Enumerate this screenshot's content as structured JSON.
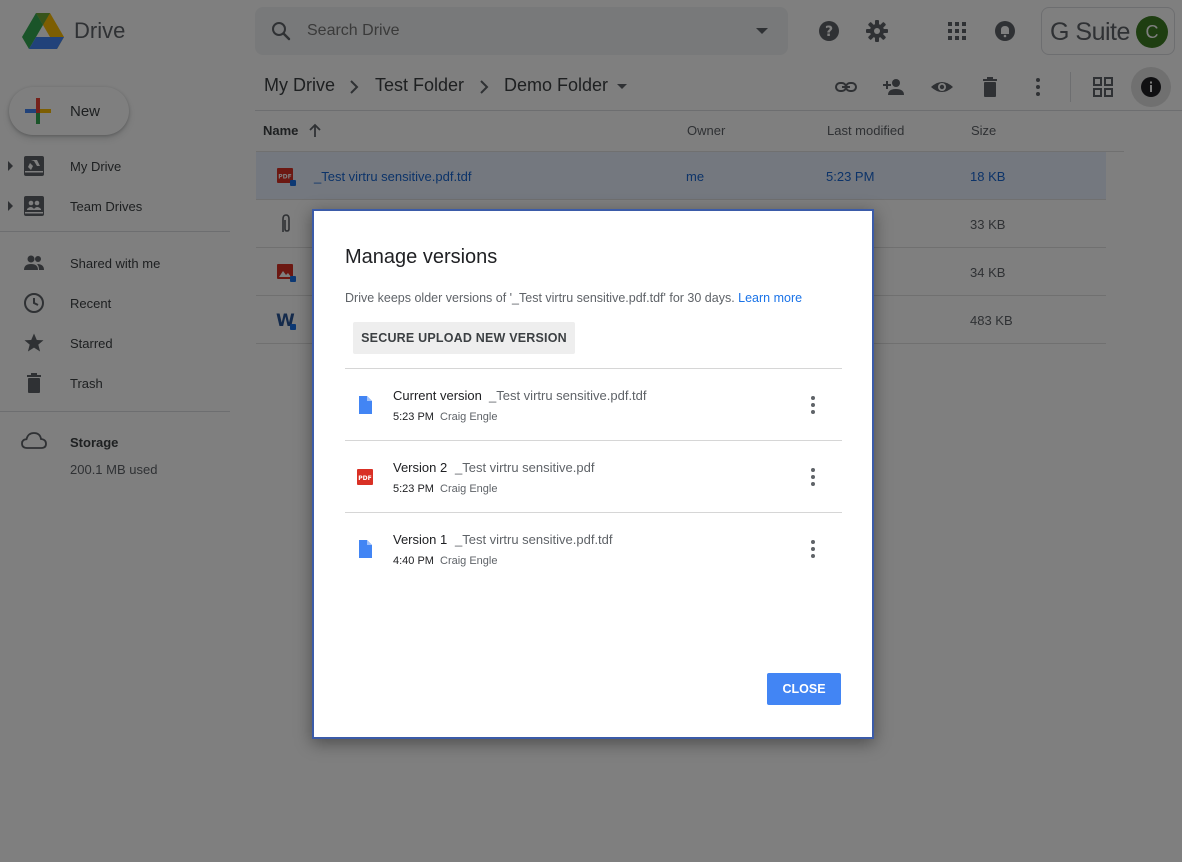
{
  "app": {
    "name": "Drive"
  },
  "search": {
    "placeholder": "Search Drive"
  },
  "header": {
    "gsuite_label": "G Suite",
    "avatar_initial": "C"
  },
  "sidebar": {
    "new_label": "New",
    "items": [
      {
        "label": "My Drive",
        "icon": "my-drive-icon"
      },
      {
        "label": "Team Drives",
        "icon": "team-drives-icon"
      },
      {
        "label": "Shared with me",
        "icon": "people-icon"
      },
      {
        "label": "Recent",
        "icon": "clock-icon"
      },
      {
        "label": "Starred",
        "icon": "star-icon"
      },
      {
        "label": "Trash",
        "icon": "trash-icon"
      }
    ],
    "storage_title": "Storage",
    "storage_used": "200.1 MB used"
  },
  "breadcrumb": [
    "My Drive",
    "Test Folder",
    "Demo Folder"
  ],
  "list": {
    "headers": {
      "name": "Name",
      "owner": "Owner",
      "modified": "Last modified",
      "size": "Size"
    },
    "rows": [
      {
        "name": "_Test virtru sensitive.pdf.tdf",
        "owner": "me",
        "modified": "5:23 PM",
        "size": "18 KB",
        "icon": "pdf-file-icon",
        "selected": true
      },
      {
        "name": "",
        "owner": "",
        "modified": "",
        "size": "33 KB",
        "icon": "attachment-file-icon"
      },
      {
        "name": "",
        "owner": "",
        "modified": "",
        "size": "34 KB",
        "icon": "image-file-icon"
      },
      {
        "name": "",
        "owner": "",
        "modified": "",
        "size": "483 KB",
        "icon": "word-file-icon"
      }
    ]
  },
  "dialog": {
    "title": "Manage versions",
    "description": "Drive keeps older versions of '_Test virtru sensitive.pdf.tdf' for 30 days.",
    "learn_more": "Learn more",
    "upload_label": "SECURE UPLOAD NEW VERSION",
    "versions": [
      {
        "label": "Current version",
        "file": "_Test virtru sensitive.pdf.tdf",
        "time": "5:23 PM",
        "user": "Craig Engle",
        "icon": "doc-file-icon"
      },
      {
        "label": "Version 2",
        "file": "_Test virtru sensitive.pdf",
        "time": "5:23 PM",
        "user": "Craig Engle",
        "icon": "pdf-file-icon"
      },
      {
        "label": "Version 1",
        "file": "_Test virtru sensitive.pdf.tdf",
        "time": "4:40 PM",
        "user": "Craig Engle",
        "icon": "doc-file-icon"
      }
    ],
    "close_label": "CLOSE"
  },
  "colors": {
    "accent": "#4285f4",
    "link": "#1a73e8",
    "selected_row": "#e8f0fe",
    "avatar": "#3c7d22",
    "pdf_red": "#d93025"
  }
}
